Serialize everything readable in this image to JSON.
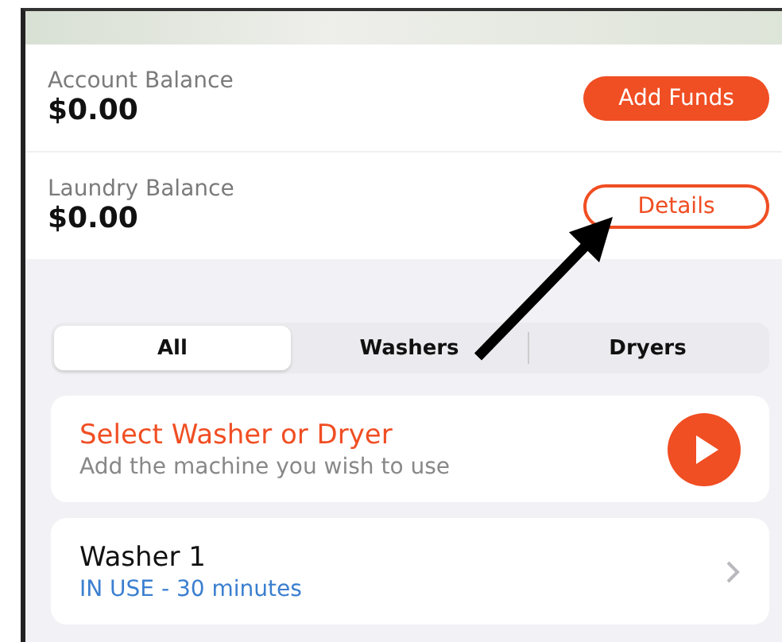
{
  "balances": [
    {
      "label": "Account Balance",
      "amount": "$0.00",
      "action": {
        "label": "Add Funds",
        "kind": "filled"
      }
    },
    {
      "label": "Laundry Balance",
      "amount": "$0.00",
      "action": {
        "label": "Details",
        "kind": "outline"
      }
    }
  ],
  "tabs": [
    {
      "label": "All",
      "selected": true
    },
    {
      "label": "Washers",
      "selected": false
    },
    {
      "label": "Dryers",
      "selected": false
    }
  ],
  "select_card": {
    "title": "Select Washer or Dryer",
    "subtitle": "Add the machine you wish to use"
  },
  "machines": [
    {
      "name": "Washer 1",
      "status": "IN USE - 30 minutes"
    }
  ]
}
